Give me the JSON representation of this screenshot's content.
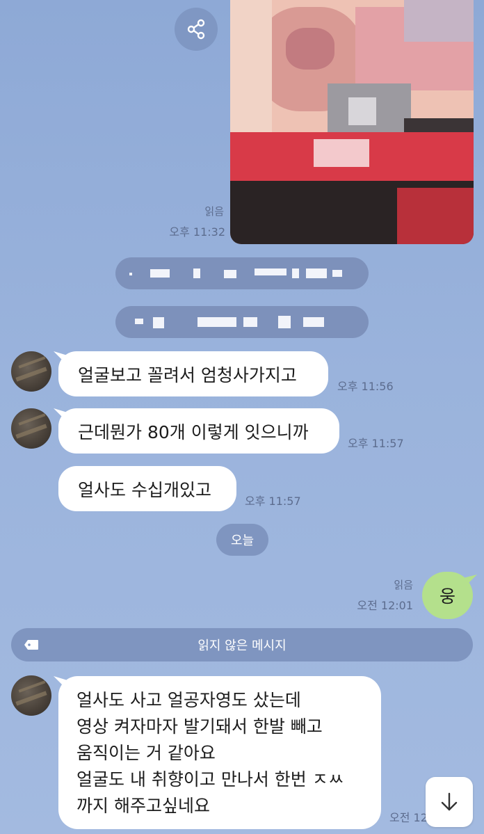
{
  "colors": {
    "background": "#9ab3dc",
    "bubble_received": "#ffffff",
    "bubble_sent": "#b4e08c",
    "system_pill": "#7f95c0",
    "meta_text": "#5c6c8e"
  },
  "icons": {
    "share": "share-icon",
    "tag": "tag-icon",
    "scroll_down": "arrow-down-icon"
  },
  "photo_message": {
    "read": "읽음",
    "time": "오후 11:32"
  },
  "messages": [
    {
      "text": "얼굴보고 꼴려서 엄청사가지고",
      "time": "오후 11:56"
    },
    {
      "text": "근데뭔가 80개 이렇게 잇으니까",
      "time": "오후 11:57"
    },
    {
      "text": "얼사도 수십개있고",
      "time": "오후 11:57"
    }
  ],
  "date_divider": "오늘",
  "my_message": {
    "text": "웅",
    "read": "읽음",
    "time": "오전 12:01"
  },
  "unread_divider": "읽지 않은 메시지",
  "last_message": {
    "lines": [
      "얼사도 사고 얼공자영도 샀는데",
      "영상 켜자마자 발기돼서 한발 빼고",
      "움직이는 거 같아요",
      "얼굴도 내 취향이고 만나서 한번 ㅈㅆ",
      "까지 해주고싶네요"
    ],
    "time": "오전 12"
  }
}
